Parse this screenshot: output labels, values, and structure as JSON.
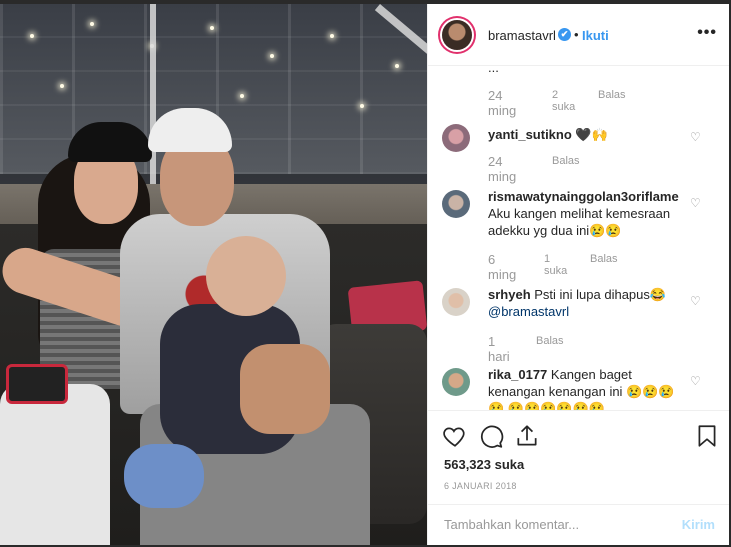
{
  "post": {
    "username": "bramastavrl",
    "verified": "✔",
    "separator": "•",
    "follow_label": "Ikuti",
    "more_icon": "more-options-icon",
    "likes": "563,323 suka",
    "date": "6 JANUARI 2018"
  },
  "comments_partial": {
    "text": "...",
    "time": "24 ming",
    "likes": "2 suka",
    "reply": "Balas"
  },
  "comments": [
    {
      "username": "yanti_sutikno",
      "text": "🖤🙌",
      "time": "24 ming",
      "likes": "",
      "reply": "Balas"
    },
    {
      "username": "rismawatynainggolan3oriflame",
      "text": "Aku kangen melihat kemesraan adekku yg dua ini😢😢",
      "time": "6 ming",
      "likes": "1 suka",
      "reply": "Balas"
    },
    {
      "username": "srhyeh",
      "text": "Psti ini lupa dihapus😂",
      "mention": "@bramastavrl",
      "time": "1 hari",
      "likes": "",
      "reply": "Balas"
    },
    {
      "username": "rika_0177",
      "text": "Kangen baget kenangan kenangan ini 😢😢😢😢 😢😢😢😢😢😢",
      "time": "",
      "likes": "",
      "reply": ""
    }
  ],
  "add_comment": {
    "placeholder": "Tambahkan komentar...",
    "post_label": "Kirim"
  },
  "colors": {
    "accent": "#3897f0",
    "text": "#262626",
    "muted": "#999999",
    "border": "#efefef"
  }
}
